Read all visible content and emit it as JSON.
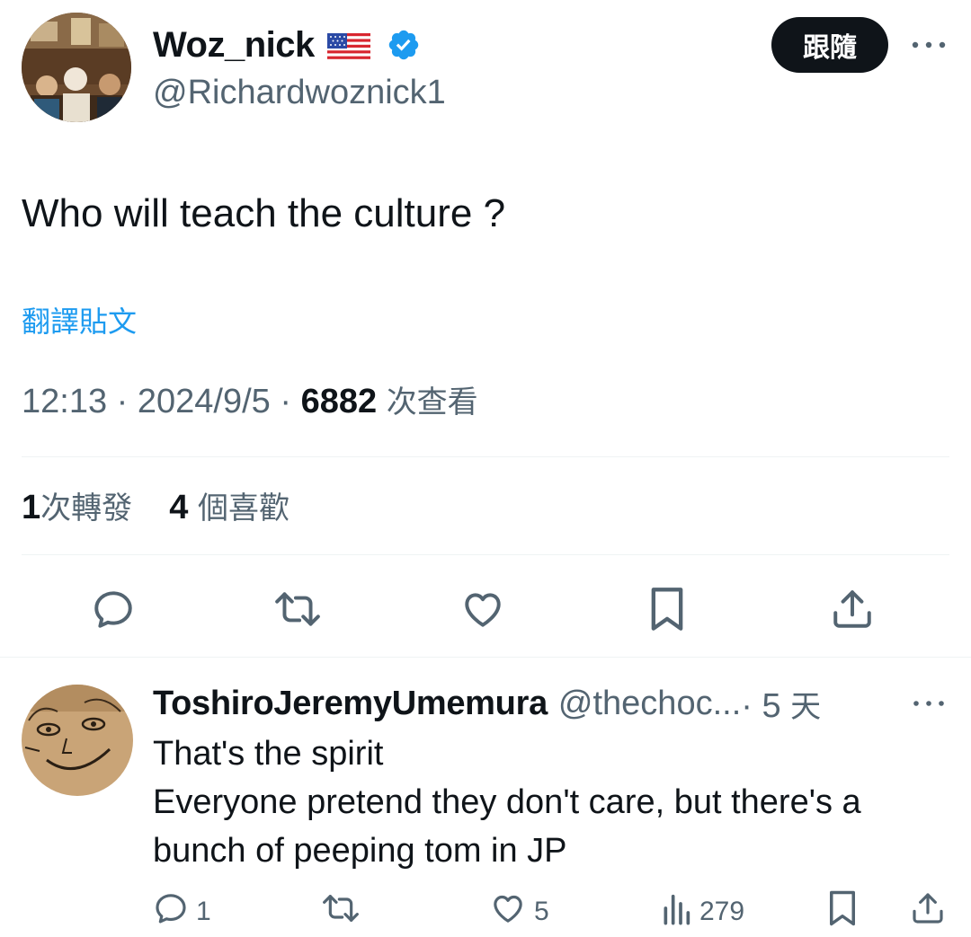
{
  "tweet": {
    "author": {
      "display_name": "Woz_nick",
      "handle": "@Richardwoznick1",
      "flag_icon": "us-flag-icon",
      "verified_icon": "verified-badge-icon"
    },
    "follow_label": "跟隨",
    "text": "Who will teach the culture ?",
    "translate_label": "翻譯貼文",
    "time": "12:13",
    "date": "2024/9/5",
    "views_count": "6882",
    "views_label": "次查看",
    "retweets_count": "1",
    "retweets_label": "次轉發",
    "likes_count": "4",
    "likes_label": "個喜歡"
  },
  "actions": {
    "icons": [
      "reply-icon",
      "retweet-icon",
      "like-icon",
      "bookmark-icon",
      "share-icon"
    ]
  },
  "reply": {
    "display_name": "ToshiroJeremyUmemura",
    "handle": "@thechoc...",
    "separator": " · ",
    "time_num": "5",
    "time_unit": "天",
    "text_line1": "That's the spirit",
    "text_line2": "Everyone pretend they don't care, but there's a",
    "text_line3": "bunch of peeping tom in JP",
    "reply_count": "1",
    "like_count": "5",
    "views_count": "279"
  },
  "colors": {
    "accent": "#1d9bf0",
    "text": "#0f1419",
    "muted": "#536471",
    "divider": "#eff3f4"
  }
}
